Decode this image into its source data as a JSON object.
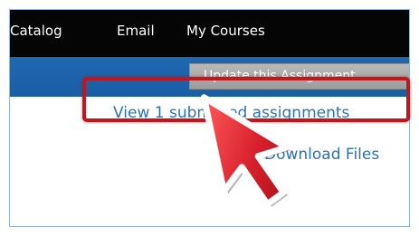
{
  "topnav": {
    "items": [
      "Catalog",
      "Email",
      "My Courses"
    ]
  },
  "toolbar": {
    "update_label": "Update this Assignment"
  },
  "links": {
    "view_submitted": "View 1 submitted assignments",
    "download_files": "Download Files"
  },
  "colors": {
    "nav_bg": "#050505",
    "toolbar_bg": "#1f68b2",
    "link": "#2a73b8",
    "highlight": "#c2161f",
    "cursor": "#d7202c"
  },
  "icons": {
    "cursor": "mouse-pointer-icon"
  }
}
